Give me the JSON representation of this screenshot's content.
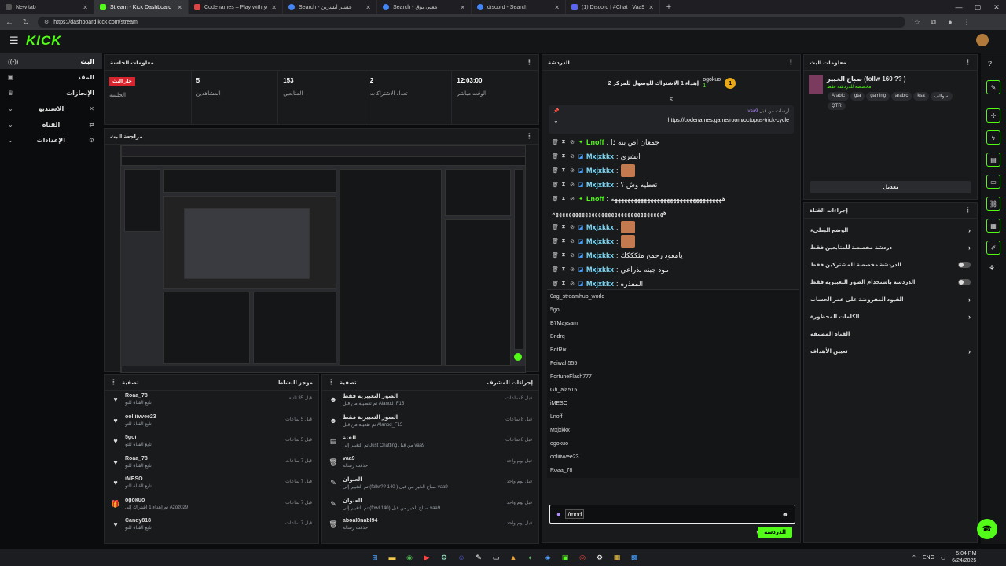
{
  "browser": {
    "tabs": [
      {
        "label": "New tab",
        "icon": "new-tab-icon",
        "active": false
      },
      {
        "label": "Stream - Kick Dashboard",
        "icon": "kick-favicon",
        "active": true
      },
      {
        "label": "Codenames – Play with your Frie",
        "icon": "codenames-favicon",
        "active": false
      },
      {
        "label": "Search - عشير ابشرين",
        "icon": "search-favicon",
        "active": false
      },
      {
        "label": "Search - معني بوق",
        "icon": "search-favicon",
        "active": false
      },
      {
        "label": "discord - Search",
        "icon": "search-favicon",
        "active": false
      },
      {
        "label": "(1) Discord | #Chat | Vaa9",
        "icon": "discord-favicon",
        "active": false
      }
    ],
    "url": "https://dashboard.kick.com/stream"
  },
  "brand": {
    "logo": "KICK",
    "accent": "#53fc18"
  },
  "sidebar": {
    "items": [
      {
        "label": "البث",
        "icon": "broadcast-icon"
      },
      {
        "label": "المقد",
        "icon": "content-icon"
      },
      {
        "label": "الإنجازات",
        "icon": "trophy-icon"
      },
      {
        "label": "الاستديو",
        "icon": "studio-icon"
      },
      {
        "label": "القناة",
        "icon": "channel-icon"
      },
      {
        "label": "الإعدادات",
        "icon": "gear-icon"
      }
    ]
  },
  "session": {
    "title": "معلومات الجلسة",
    "stats": [
      {
        "value": "جار البث",
        "label": "الجلسة",
        "badge": true
      },
      {
        "value": "5",
        "label": "المشاهدين"
      },
      {
        "value": "153",
        "label": "المتابعين"
      },
      {
        "value": "2",
        "label": "تعداد الاشتراكات"
      },
      {
        "value": "12:03:00",
        "label": "الوقت مباشر"
      }
    ]
  },
  "preview": {
    "title": "مراجعة البث"
  },
  "activity": {
    "title": "موجز النشاط",
    "filter": "تصفية",
    "items": [
      {
        "name": "Roaa_78",
        "sub": "تابع القناة للتو",
        "time": "قبل 35 ثانية",
        "icon": "heart-icon"
      },
      {
        "name": "ooliiivvee23",
        "sub": "تابع القناة للتو",
        "time": "قبل 5 ساعات",
        "icon": "heart-icon"
      },
      {
        "name": "5goi",
        "sub": "تابع القناة للتو",
        "time": "قبل 5 ساعات",
        "icon": "heart-icon"
      },
      {
        "name": "Roaa_78",
        "sub": "تابع القناة للتو",
        "time": "قبل 7 ساعات",
        "icon": "heart-icon"
      },
      {
        "name": "iMESO",
        "sub": "تابع القناة للتو",
        "time": "قبل 7 ساعات",
        "icon": "heart-icon"
      },
      {
        "name": "ogokuo",
        "sub": "تم إهداء 1 اشتراك إلى Azoz029",
        "time": "قبل 7 ساعات",
        "icon": "gift-icon"
      },
      {
        "name": "Candy818",
        "sub": "تابع القناة للتو",
        "time": "قبل 7 ساعات",
        "icon": "heart-icon"
      }
    ]
  },
  "modactions": {
    "title": "إجراءات المشرف",
    "filter": "تصفية",
    "items": [
      {
        "name": "الصور التعبيرية فقط",
        "sub": "تم تعطيله من قبل Alanod_F15",
        "time": "قبل 8 ساعات",
        "icon": "emote-icon"
      },
      {
        "name": "الصور التعبيرية فقط",
        "sub": "تم تفعيله من قبل Alanod_F15",
        "time": "قبل 8 ساعات",
        "icon": "emote-icon"
      },
      {
        "name": "الفئة",
        "sub": "تم التغيير إلى Just Chatting من قبل vaa9",
        "time": "قبل 8 ساعات",
        "icon": "category-icon"
      },
      {
        "name": "vaa9",
        "sub": "حذفت رسالة",
        "time": "قبل يوم واحد",
        "icon": "trash-icon"
      },
      {
        "name": "العنوان",
        "sub": "تم التغيير إلى (follw?? 140 ) صباح الخير من قبل vaa9",
        "time": "قبل يوم واحد",
        "icon": "edit-icon"
      },
      {
        "name": "العنوان",
        "sub": "تم التغيير إلى (fowl 140) صباح الخير من قبل vaa9",
        "time": "قبل يوم واحد",
        "icon": "edit-icon"
      },
      {
        "name": "aboal8nabl94",
        "sub": "حذفت رسالة",
        "time": "قبل يوم واحد",
        "icon": "trash-icon"
      }
    ]
  },
  "chat": {
    "title": "الدردشة",
    "gifter": {
      "name": "ogokuo",
      "count": "1",
      "rank": "1",
      "text": "إهداء 1 الاشتراك للوصول للمركز 2"
    },
    "pinned": {
      "by": "vaa9",
      "label": "أرسلت من قبل",
      "link": "https://codenames.game/room/octopus-trick-cycle"
    },
    "messages": [
      {
        "user": "Lnoff",
        "text": "جمعان اص بنه ذا",
        "style": "gr"
      },
      {
        "user": "Mxjxkkx",
        "text": "ابشري",
        "style": "bl"
      },
      {
        "user": "Mxjxkkx",
        "text": "",
        "style": "bl",
        "emote": true
      },
      {
        "user": "Mxjxkkx",
        "text": "تعطيه وش ؟",
        "style": "bl"
      },
      {
        "user": "Lnoff",
        "text": "ههههههههههههههههههههههههههههههههههه",
        "style": "gr"
      },
      {
        "user": "",
        "text": "ههههههههههههههههههههههههههههههههههه",
        "style": "cont"
      },
      {
        "user": "Mxjxkkx",
        "text": "",
        "style": "bl",
        "emote": true
      },
      {
        "user": "Mxjxkkx",
        "text": "",
        "style": "bl",
        "emote": true
      },
      {
        "user": "Mxjxkkx",
        "text": "يامعود رحمح مثكككك",
        "style": "bl"
      },
      {
        "user": "Mxjxkkx",
        "text": "مود جبنه بذراعي",
        "style": "bl"
      },
      {
        "user": "Mxjxkkx",
        "text": "المعذره",
        "style": "bl"
      }
    ],
    "mentions": [
      "0ag_streamhub_world",
      "5goi",
      "B7Maysam",
      "Bndrq",
      "BotRix",
      "Feiwah555",
      "FortuneFlash777",
      "Gh_ala515",
      "iMESO",
      "Lnoff",
      "Mxjxkkx",
      "ogokuo",
      "ooliiivvee23",
      "Roaa_78"
    ],
    "input_value": "/mod",
    "send_label": "الدردشة"
  },
  "streaminfo": {
    "title": "معلومات البث",
    "stream_title": "صباح الخيير (follw 160 ?? )",
    "category": "مخصصة للدردشة فقط",
    "tags": [
      "Arabic",
      "gta",
      "gaming",
      "arabic",
      "ksa",
      "سوالف",
      "QTR"
    ],
    "edit_label": "تعديل"
  },
  "channelactions": {
    "title": "إجراءات القناة",
    "rows": [
      {
        "label": "الوضع البطيء",
        "control": "chevron"
      },
      {
        "label": "دردشة مخصصة للمتابعين فقط",
        "control": "chevron"
      },
      {
        "label": "الدردشة مخصصة للمشتركين فقط",
        "control": "toggle"
      },
      {
        "label": "الدردشة باستخدام الصور التعبيرية فقط",
        "control": "toggle"
      },
      {
        "label": "القيود المفروضة على عمر الحساب",
        "control": "chevron"
      },
      {
        "label": "الكلمات المحظورة",
        "control": "chevron"
      },
      {
        "label": "القناة المضيفة",
        "control": "none"
      },
      {
        "label": "تعيين الأهداف",
        "control": "chevron"
      }
    ]
  },
  "taskbar": {
    "time": "5:04 PM",
    "date": "6/24/2025",
    "lang": "ENG"
  }
}
